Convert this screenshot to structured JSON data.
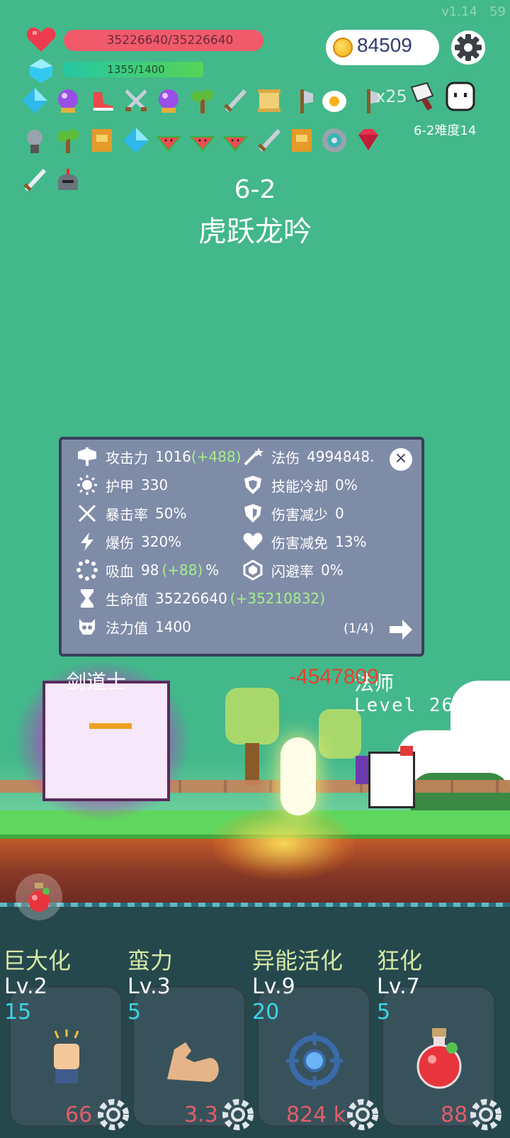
{
  "version": "v1.14",
  "fps": "59",
  "hp": {
    "text": "35226640/35226640",
    "fill": 1.0
  },
  "mp": {
    "text": "1355/1400",
    "fill": 0.968
  },
  "coins": "84509",
  "inventory_count": "x25",
  "boss": {
    "difficulty": "6-2难度14"
  },
  "stage": {
    "number": "6-2",
    "name": "虎跃龙吟"
  },
  "stats": {
    "attack": {
      "label": "攻击力",
      "value": "1016",
      "bonus": "(+488)"
    },
    "magic_damage": {
      "label": "法伤",
      "value": "4994848."
    },
    "armor": {
      "label": "护甲",
      "value": "330"
    },
    "cooldown": {
      "label": "技能冷却",
      "value": "0%"
    },
    "crit_rate": {
      "label": "暴击率",
      "value": "50%"
    },
    "dmg_reduce": {
      "label": "伤害减少",
      "value": "0"
    },
    "crit_dmg": {
      "label": "爆伤",
      "value": "320%"
    },
    "dmg_immune": {
      "label": "伤害减免",
      "value": "13%"
    },
    "lifesteal": {
      "label": "吸血",
      "value": "98",
      "bonus": "(+88)",
      "unit": "%"
    },
    "dodge": {
      "label": "闪避率",
      "value": "0%"
    },
    "hp": {
      "label": "生命值",
      "value": "35226640",
      "bonus": "(+35210832)"
    },
    "mana": {
      "label": "法力值",
      "value": "1400"
    },
    "page": "(1/4)"
  },
  "battle": {
    "damage": "-4547809",
    "left_name": "剑道士",
    "right_name": "法师",
    "right_level": "Level 26"
  },
  "skills": [
    {
      "name": "巨大化",
      "level": "Lv.2",
      "cost": "15",
      "count": "66"
    },
    {
      "name": "蛮力",
      "level": "Lv.3",
      "cost": "5",
      "count": "3.3"
    },
    {
      "name": "异能活化",
      "level": "Lv.9",
      "cost": "20",
      "count": "824 k"
    },
    {
      "name": "狂化",
      "level": "Lv.7",
      "cost": "5",
      "count": "88"
    }
  ],
  "colors": {
    "background": "#43b88a",
    "hp": "#f05a6a",
    "panel": "#7f8ca8",
    "damage": "#e8402e"
  }
}
